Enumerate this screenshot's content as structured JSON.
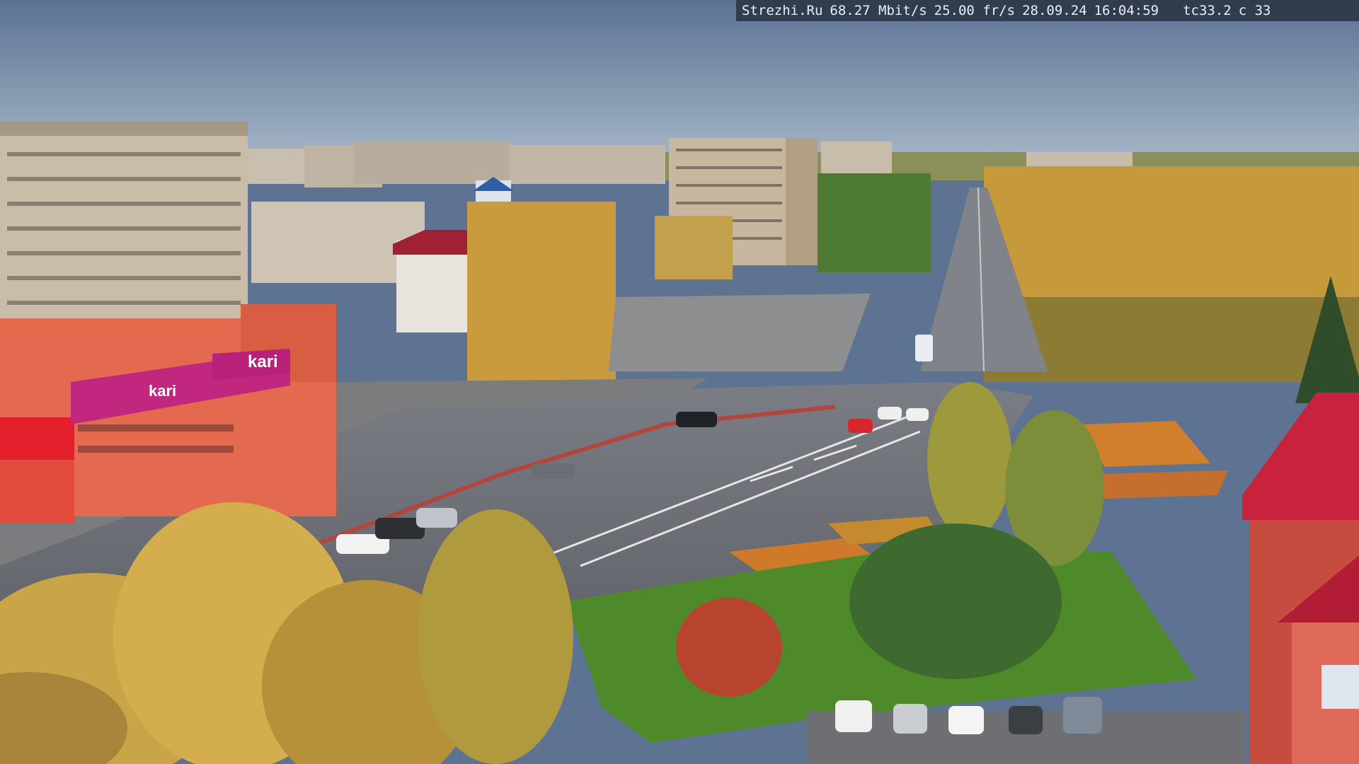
{
  "overlay": {
    "site": "Strezhi.Ru",
    "bitrate": "68.27 Mbit/s",
    "framerate": "25.00 fr/s",
    "date": "28.09.24",
    "time": "16:04:59",
    "code1": "tc33.2",
    "code2": "c 33"
  },
  "signs": {
    "shop_upper": "kari",
    "shop_lower": "kari"
  },
  "colors": {
    "sky": "#6f86a3",
    "shop_facade": "#e36a4f",
    "shop_sign": "#c1277f",
    "road": "#6b6f74",
    "autumn_foliage": "#d7a63a",
    "grass": "#4f8a2a"
  }
}
